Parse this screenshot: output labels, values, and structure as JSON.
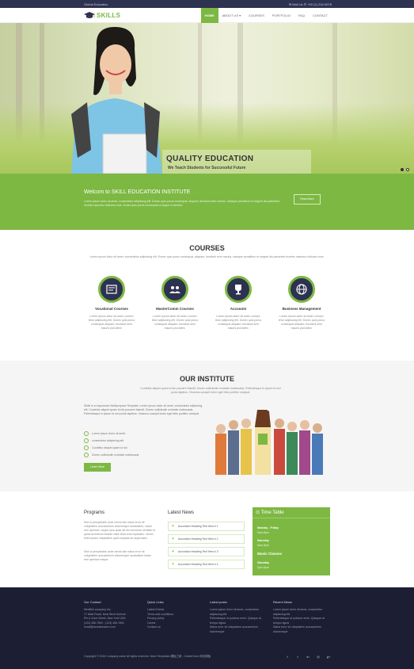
{
  "topbar": {
    "left_text": "Global Education",
    "right_text": "✉ Mail Us  ✆ +00 (1) 234-5678"
  },
  "brand": {
    "name": "SKILLS",
    "accent": "#7db843",
    "dark": "#2d3250"
  },
  "nav": {
    "items": [
      "HOME",
      "ABOUT US ▾",
      "COURSES",
      "PORTFOLIO",
      "FAQ",
      "CONTACT"
    ],
    "active": "HOME"
  },
  "hero": {
    "title": "QUALITY EDUCATION",
    "subtitle": "We Teach Students for Successful Future",
    "slides": 2,
    "current_slide": 1
  },
  "welcome": {
    "heading": "Welcom to SKILL EDUCATION INSTITUTE",
    "text": "Lorem ipsum dolor sit amet, consectetur adipiscing elit. Donec quis purus consequat, aliquam, tincidunt sem mauris, natoque penatibus et magnis dis parturient montes nascetur ridiculus mus. Donec quis purus consequat ut augue ut laoreet.",
    "button": "Read More"
  },
  "courses": {
    "title": "COURSES",
    "intro": "Lorem ipsum dolor sit amet, consectetur adipiscing elit. Donec quis purus consequat, aliquam, tincidunt sem mauris, natoque penatibus et magnis dis parturient montes nascetur ridiculus mus.",
    "items": [
      {
        "title": "Vocational Courses",
        "text": "Lorem ipsum dolor sit amet, consec tetur adipiscing elit. Donec quis purus consequat aliquam, tincidunt sem mauris provident."
      },
      {
        "title": "MasterComm Courses",
        "text": "Lorem ipsum dolor sit amet, consec tetur adipiscing elit. Donec quis purus consequat aliquam, tincidunt sem mauris provident."
      },
      {
        "title": "Accounts",
        "text": "Lorem ipsum dolor sit amet, consec tetur adipiscing elit. Donec quis purus consequat aliquam, tincidunt sem mauris provident."
      },
      {
        "title": "Business Management",
        "text": "Lorem ipsum dolor sit amet, consec tetur adipiscing elit. Donec quis purus consequat aliquam, tincidunt sem mauris provident."
      }
    ]
  },
  "institute": {
    "title": "OUR INSTITUTE",
    "intro": "Curabitur aliquet quam id dui posuere blandit. Donec sollicitudin molestie malesuada. Pellentesque in ipsum id orci porta dapibus. Vivamus suscipit tortor eget felis porttitor volutpat.",
    "paragraph": "Skills is a responsive Multipurpose Template. Lorem ipsum dolor sit amet, consectetur adipiscing elit. Curabitur aliquet quam id dui posuere blandit. Donec sollicitudin molestie malesuada. Pellentesque in ipsum id orci porta dapibus. Vivamus suscipit tortor eget felis porttitor volutpat.",
    "checklist": [
      "Lorem ipsum dolor sit amet",
      "consectetur adipiscing elit",
      "Curabitur aliquet quam id dui",
      "Donec sollicitudin molestie malesuada"
    ],
    "button": "Learn More"
  },
  "programs": {
    "heading": "Programs",
    "p1": "Sed ut perspiciatis unde omnis iste natus error sit voluptatem accusantium doloremque laudantium, totam rem aperiam, eaque ipsa quae ab illo inventore veritatis et quasi architecto beatae vitae dicta sunt explicabo. Nemo enim ipsam voluptatem quia voluptas sit aspernatur.",
    "p2": "Sed ut perspiciatis unde omnis iste natus error sit voluptatem accusantium doloremque laudantium totam rem aperiam eaque."
  },
  "news": {
    "heading": "Latest News",
    "items": [
      "Accordion Heading Text Item # 1",
      "Accordion Heading Text Item # 2",
      "Accordion Heading Text Item # 3",
      "Accordion Heading Text Item # 4"
    ]
  },
  "timetable": {
    "heading": "⊙ Time Table",
    "rows": [
      {
        "label": "Monday - Friday",
        "value": "9am-5pm"
      },
      {
        "label": "Saturday",
        "value": "9am-5pm"
      },
      {
        "label": "Music Classes",
        "value": ""
      },
      {
        "label": "Saturday",
        "value": "2pm-5pm"
      }
    ]
  },
  "footer": {
    "contact": {
      "heading": "Our Contact",
      "lines": [
        "Medilink company Inc.",
        "17 Main Road, Near Birch Avenue",
        "Pin & Zone Street, New York USA",
        "(123) 456-7890 - (123) 456-7891",
        "email@domainname.com"
      ]
    },
    "quick": {
      "heading": "Quick Links",
      "lines": [
        "Latest Events",
        "Terms and conditions",
        "Privacy policy",
        "Career",
        "Contact us"
      ]
    },
    "posts": {
      "heading": "Latest posts",
      "lines": [
        "Lorem ipsum dolor sit amet, consectetur adipiscing elit.",
        "Pellentesque et pulvinar enim. Quisque at tempor ligula",
        "Natus error sit voluptatem accusantium doloremque"
      ]
    },
    "recent": {
      "heading": "Recent News",
      "lines": [
        "Lorem ipsum dolor sit amet, consectetur adipiscing elit.",
        "Pellentesque et pulvinar enim. Quisque at tempor ligula",
        "Natus error sit voluptatem accusantium doloremque"
      ]
    },
    "copyright": "Copyright © 2016 Company name All rights reserved. More Templates 模板之家 - Collect from 网页模板",
    "social": [
      "f",
      "t",
      "in",
      "◎",
      "g+"
    ]
  }
}
